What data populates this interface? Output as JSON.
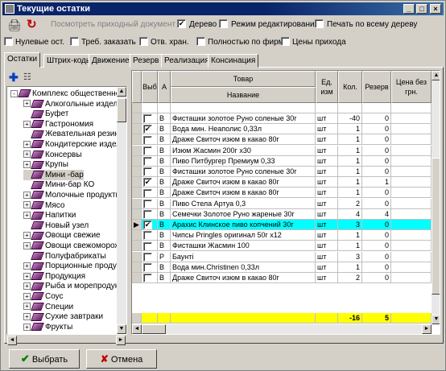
{
  "window": {
    "title": "Текущие остатки"
  },
  "toolbar": {
    "preview_label": "Посмотреть приходный документ",
    "tree_label": "Дерево",
    "tree_checked": "✔",
    "edit_mode_label": "Режим редактирования",
    "print_tree_label": "Печать по всему дереву"
  },
  "filters": {
    "zero": "Нулевые ост.",
    "order": "Треб. заказать",
    "resp": "Отв. хран.",
    "firm": "Полностью по фирме",
    "prices": "Цены прихода"
  },
  "tabs": [
    "Остатки",
    "Штрих-коды",
    "Движение",
    "Резерв",
    "Реализация",
    "Консинация"
  ],
  "tree": [
    {
      "label": "Комплекс общественно",
      "exp": "-"
    },
    {
      "label": "Алкогольные издели",
      "exp": "+"
    },
    {
      "label": "Буфет",
      "exp": ""
    },
    {
      "label": "Гастрономия",
      "exp": "+"
    },
    {
      "label": "Жевательная резин",
      "exp": ""
    },
    {
      "label": "Кондитерские издел",
      "exp": "+"
    },
    {
      "label": "Консервы",
      "exp": "+"
    },
    {
      "label": "Крупы",
      "exp": "+"
    },
    {
      "label": "Мини -бар",
      "exp": ""
    },
    {
      "label": "Мини-бар КО",
      "exp": ""
    },
    {
      "label": "Молочные продукты",
      "exp": "+"
    },
    {
      "label": "Мясо",
      "exp": "+"
    },
    {
      "label": "Напитки",
      "exp": "+"
    },
    {
      "label": "Новый узел",
      "exp": ""
    },
    {
      "label": "Овощи свежие",
      "exp": "+"
    },
    {
      "label": "Овощи свежоморож",
      "exp": "+"
    },
    {
      "label": "Полуфабрикаты",
      "exp": ""
    },
    {
      "label": "Порционные продукт",
      "exp": "+"
    },
    {
      "label": "Продукция",
      "exp": "+"
    },
    {
      "label": "Рыба и морепродукт",
      "exp": "+"
    },
    {
      "label": "Соус",
      "exp": "+"
    },
    {
      "label": "Специи",
      "exp": "+"
    },
    {
      "label": "Сухие завтраки",
      "exp": "+"
    },
    {
      "label": "Фрукты",
      "exp": "+"
    }
  ],
  "grid": {
    "headers": {
      "vyb": "Выб",
      "a": "А",
      "tovar": "Товар",
      "name": "Название",
      "ed": "Ед. изм",
      "kol": "Кол.",
      "rezerv": "Резерв",
      "price": "Цена без грн."
    },
    "rows": [
      {
        "chk": "",
        "a": "В",
        "name": "Фисташки золотое Руно соленые 30г",
        "ed": "шт",
        "kol": "-40",
        "rez": "0"
      },
      {
        "chk": "✔",
        "a": "В",
        "name": "Вода мин. Неаполис 0,33л",
        "ed": "шт",
        "kol": "1",
        "rez": "0"
      },
      {
        "chk": "",
        "a": "В",
        "name": "Драже Свиточ изюм в какао 80г",
        "ed": "шт",
        "kol": "1",
        "rez": "0"
      },
      {
        "chk": "",
        "a": "В",
        "name": "Изюм Жасмин 200г х30",
        "ed": "шт",
        "kol": "1",
        "rez": "0"
      },
      {
        "chk": "",
        "a": "В",
        "name": "Пиво Питбургер Премиум 0,33",
        "ed": "шт",
        "kol": "1",
        "rez": "0"
      },
      {
        "chk": "",
        "a": "В",
        "name": "Фисташки золотое Руно соленые 30г",
        "ed": "шт",
        "kol": "1",
        "rez": "0"
      },
      {
        "chk": "✔",
        "a": "В",
        "name": "Драже Свиточ изюм в какао 80г",
        "ed": "шт",
        "kol": "1",
        "rez": "1"
      },
      {
        "chk": "",
        "a": "В",
        "name": "Драже Свиточ изюм в какао 80г",
        "ed": "шт",
        "kol": "1",
        "rez": "0"
      },
      {
        "chk": "",
        "a": "В",
        "name": "Пиво Стела Артуа 0,3",
        "ed": "шт",
        "kol": "2",
        "rez": "0"
      },
      {
        "chk": "",
        "a": "В",
        "name": "Семечки Золотое Руно жареные 30г",
        "ed": "шт",
        "kol": "4",
        "rez": "4"
      },
      {
        "chk": "✔",
        "a": "В",
        "name": "Арахис Клинское пиво копчений 30г",
        "ed": "шт",
        "kol": "3",
        "rez": "0",
        "sel": true
      },
      {
        "chk": "",
        "a": "В",
        "name": "Чипсы Pringles оригинал 50г х12",
        "ed": "шт",
        "kol": "1",
        "rez": "0"
      },
      {
        "chk": "",
        "a": "В",
        "name": "Фисташки Жасмин 100",
        "ed": "шт",
        "kol": "1",
        "rez": "0"
      },
      {
        "chk": "",
        "a": "Р",
        "name": "Баунті",
        "ed": "шт",
        "kol": "3",
        "rez": "0"
      },
      {
        "chk": "",
        "a": "В",
        "name": "Вода мин.Christinen 0,33л",
        "ed": "шт",
        "kol": "1",
        "rez": "0"
      },
      {
        "chk": "",
        "a": "В",
        "name": "Драже  Свиточ изюм в какао 80г",
        "ed": "шт",
        "kol": "2",
        "rez": "0"
      }
    ],
    "total_kol": "-16",
    "total_rez": "5"
  },
  "buttons": {
    "ok": "Выбрать",
    "cancel": "Отмена"
  }
}
